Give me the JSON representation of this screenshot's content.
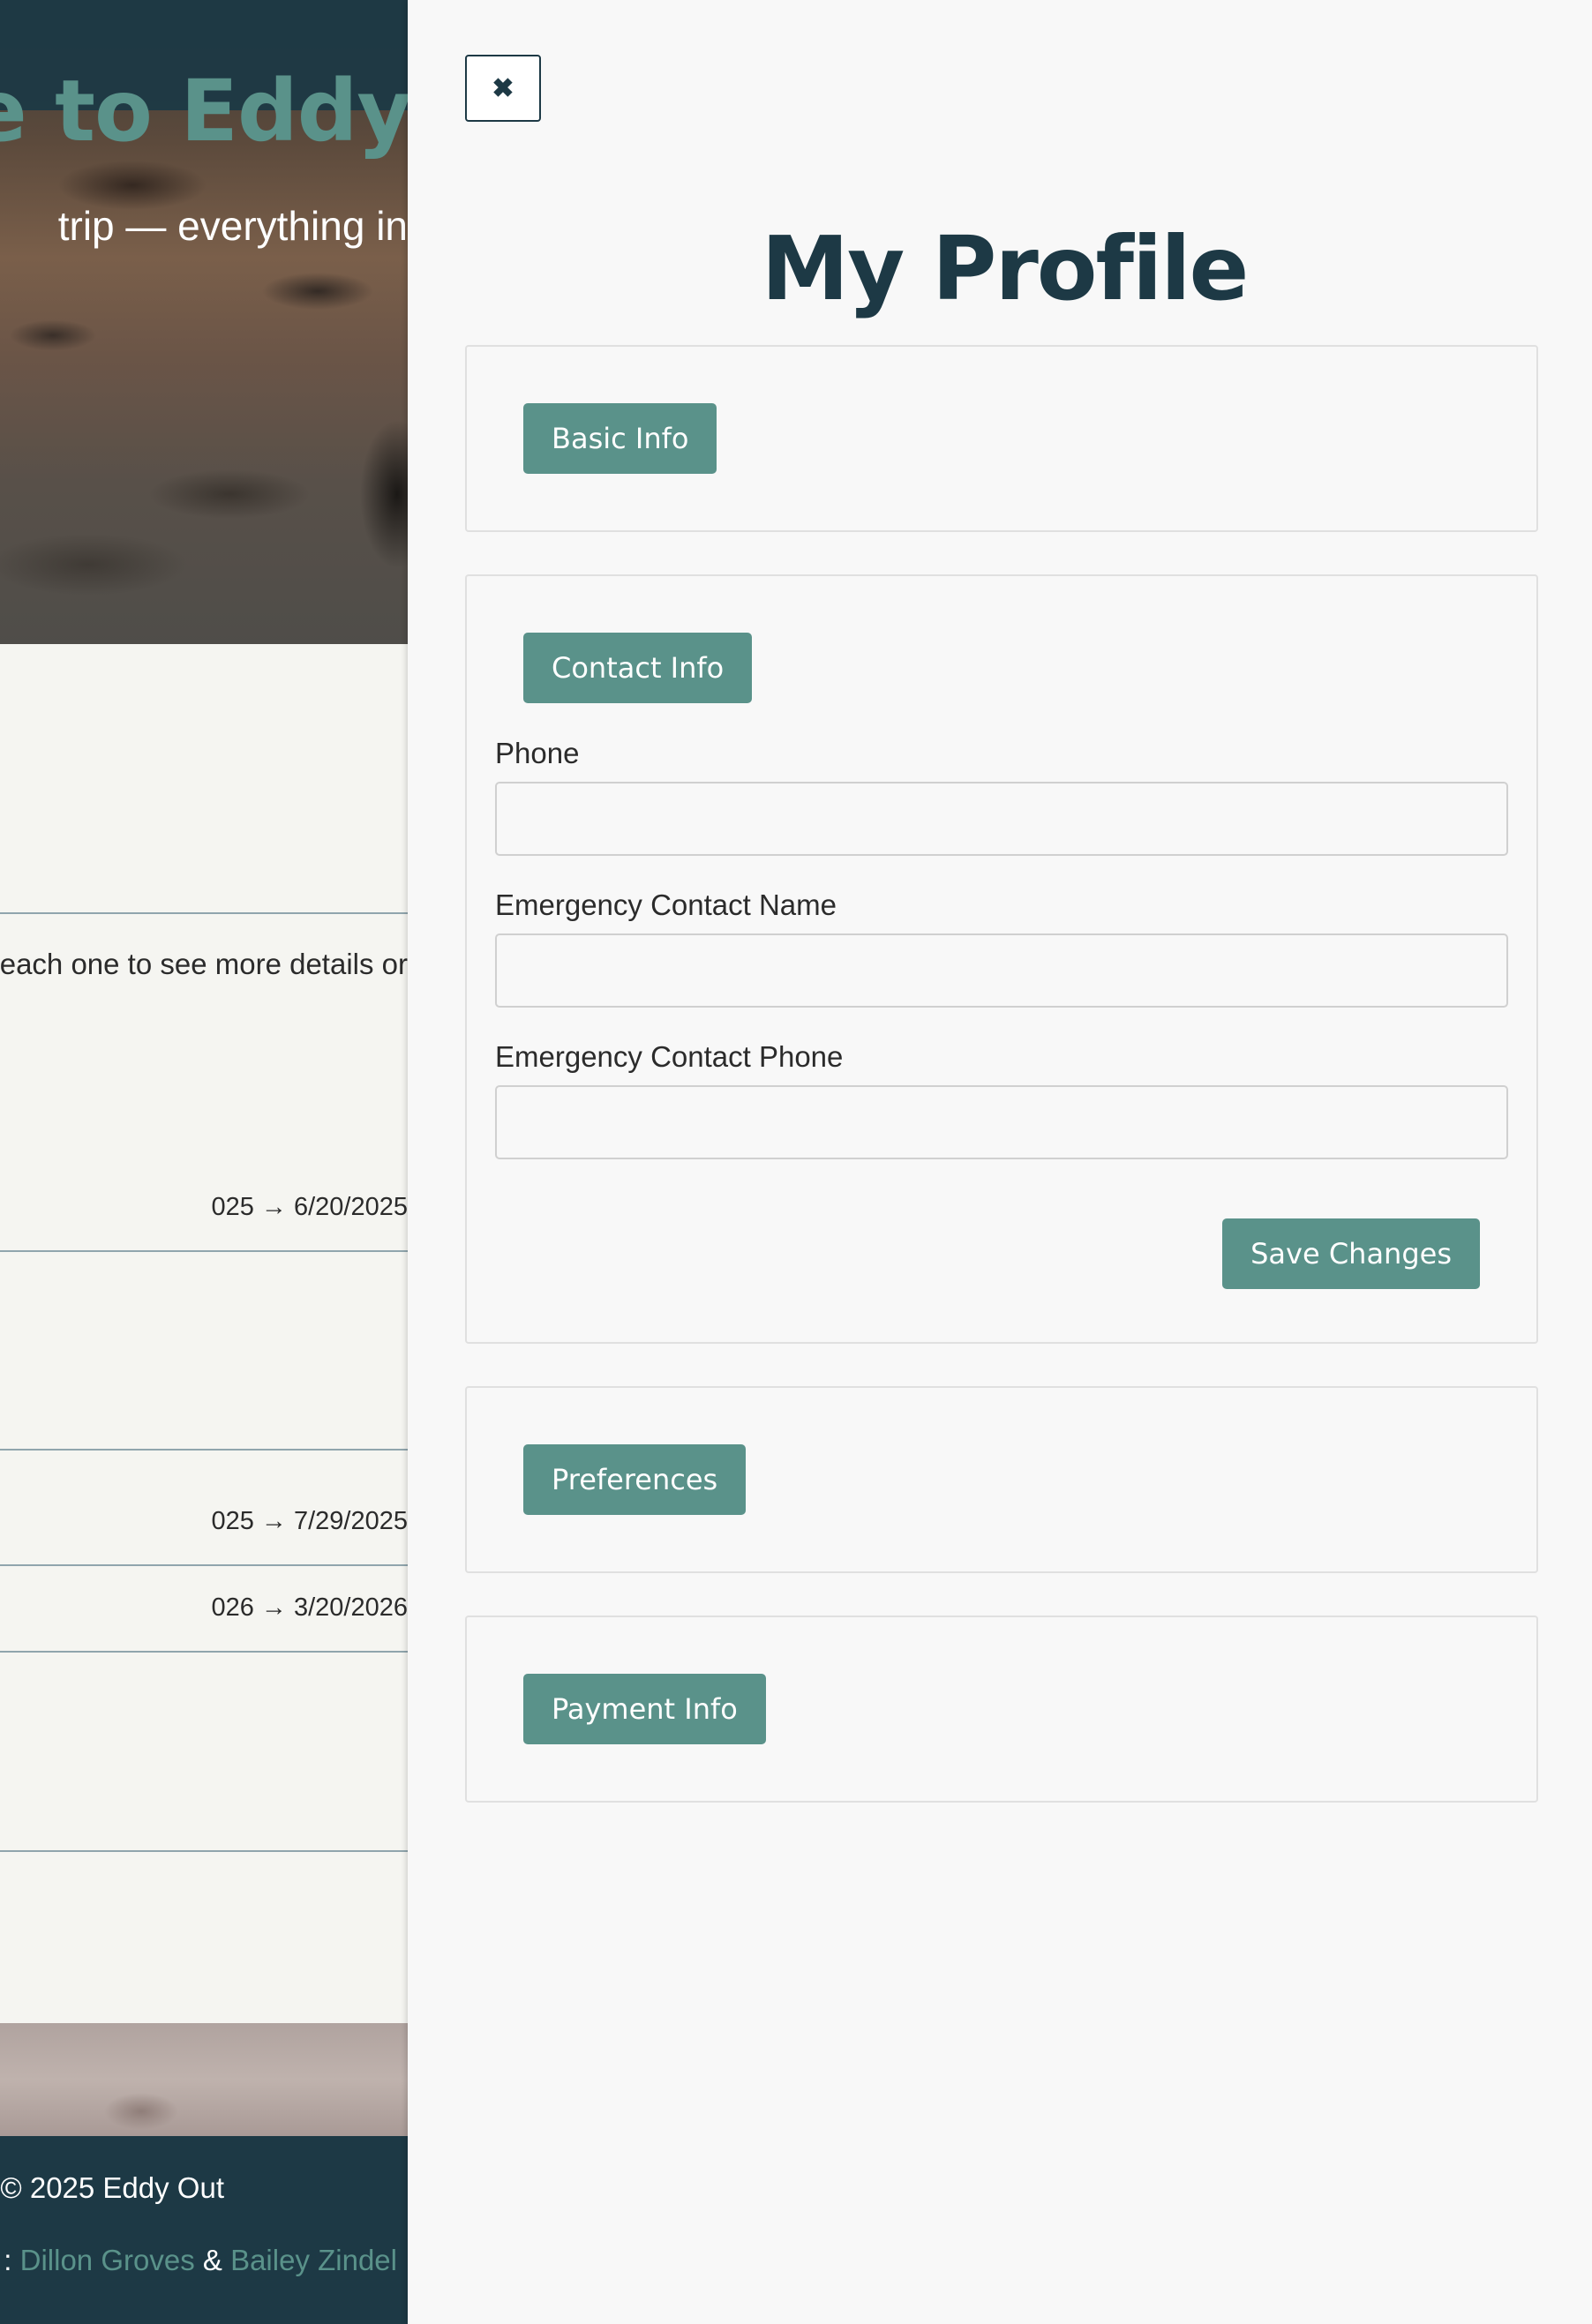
{
  "background_page": {
    "hero_heading": "e to Eddy",
    "hero_subtitle": "trip — everything in",
    "intro_text": "each one to see more details or",
    "trip_dates": [
      "025 → 6/20/2025",
      "025 → 7/29/2025",
      "026 → 3/20/2026"
    ],
    "footer": {
      "copyright": "© 2025 Eddy Out",
      "credits_prefix": ":",
      "author_1": "Dillon Groves",
      "separator": "&",
      "author_2": "Bailey Zindel"
    }
  },
  "profile_panel": {
    "close_label": "✖",
    "title": "My Profile",
    "sections": {
      "basic_info": {
        "label": "Basic Info"
      },
      "contact_info": {
        "label": "Contact Info",
        "fields": {
          "phone": {
            "label": "Phone",
            "value": ""
          },
          "emergency_name": {
            "label": "Emergency Contact Name",
            "value": ""
          },
          "emergency_phone": {
            "label": "Emergency Contact Phone",
            "value": ""
          }
        },
        "save_label": "Save Changes"
      },
      "preferences": {
        "label": "Preferences"
      },
      "payment_info": {
        "label": "Payment Info"
      }
    }
  },
  "colors": {
    "accent": "#5a928a",
    "navy": "#1d3945",
    "panel_bg": "#f8f8f8",
    "page_bg": "#f5f5f1"
  }
}
